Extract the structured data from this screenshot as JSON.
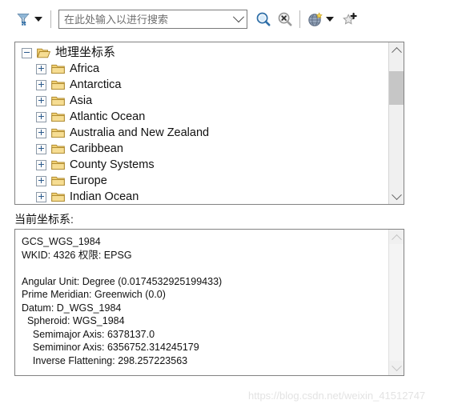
{
  "toolbar": {
    "filter_icon": "funnel-filter-icon",
    "filter_dropdown_icon": "chevron-down-icon",
    "search": {
      "placeholder": "在此处输入以进行搜索",
      "value": "",
      "dropdown_icon": "chevron-down-icon"
    },
    "search_button_icon": "magnifier-search-icon",
    "clear_search_button_icon": "magnifier-clear-icon",
    "globe_button_icon": "globe-star-icon",
    "globe_dropdown_icon": "chevron-down-icon",
    "favorite_button_icon": "star-add-icon"
  },
  "tree": {
    "root": {
      "label": "地理坐标系",
      "expander": "minus",
      "folder": "folder-open-icon"
    },
    "items": [
      {
        "label": "Africa",
        "expander": "plus",
        "folder": "folder-closed-icon"
      },
      {
        "label": "Antarctica",
        "expander": "plus",
        "folder": "folder-closed-icon"
      },
      {
        "label": "Asia",
        "expander": "plus",
        "folder": "folder-closed-icon"
      },
      {
        "label": "Atlantic Ocean",
        "expander": "plus",
        "folder": "folder-closed-icon"
      },
      {
        "label": "Australia and New Zealand",
        "expander": "plus",
        "folder": "folder-closed-icon"
      },
      {
        "label": "Caribbean",
        "expander": "plus",
        "folder": "folder-closed-icon"
      },
      {
        "label": "County Systems",
        "expander": "plus",
        "folder": "folder-closed-icon"
      },
      {
        "label": "Europe",
        "expander": "plus",
        "folder": "folder-closed-icon"
      },
      {
        "label": "Indian Ocean",
        "expander": "plus",
        "folder": "folder-closed-icon"
      }
    ],
    "scrollbar": {
      "up_icon": "chevron-up-icon",
      "down_icon": "chevron-down-icon"
    }
  },
  "current_cs": {
    "label": "当前坐标系:",
    "lines": [
      "GCS_WGS_1984",
      "WKID: 4326 权限: EPSG",
      "",
      "Angular Unit: Degree (0.0174532925199433)",
      "Prime Meridian: Greenwich (0.0)",
      "Datum: D_WGS_1984",
      "  Spheroid: WGS_1984",
      "    Semimajor Axis: 6378137.0",
      "    Semiminor Axis: 6356752.314245179",
      "    Inverse Flattening: 298.257223563"
    ],
    "scrollbar": {
      "up_icon": "chevron-up-icon",
      "down_icon": "chevron-down-icon"
    }
  },
  "watermark": "https://blog.csdn.net/weixin_41512747",
  "colors": {
    "folder": "#e8b83c",
    "accent": "#2b5a8c",
    "panel_border": "#828282",
    "scroll_thumb": "#c6c6c6"
  }
}
